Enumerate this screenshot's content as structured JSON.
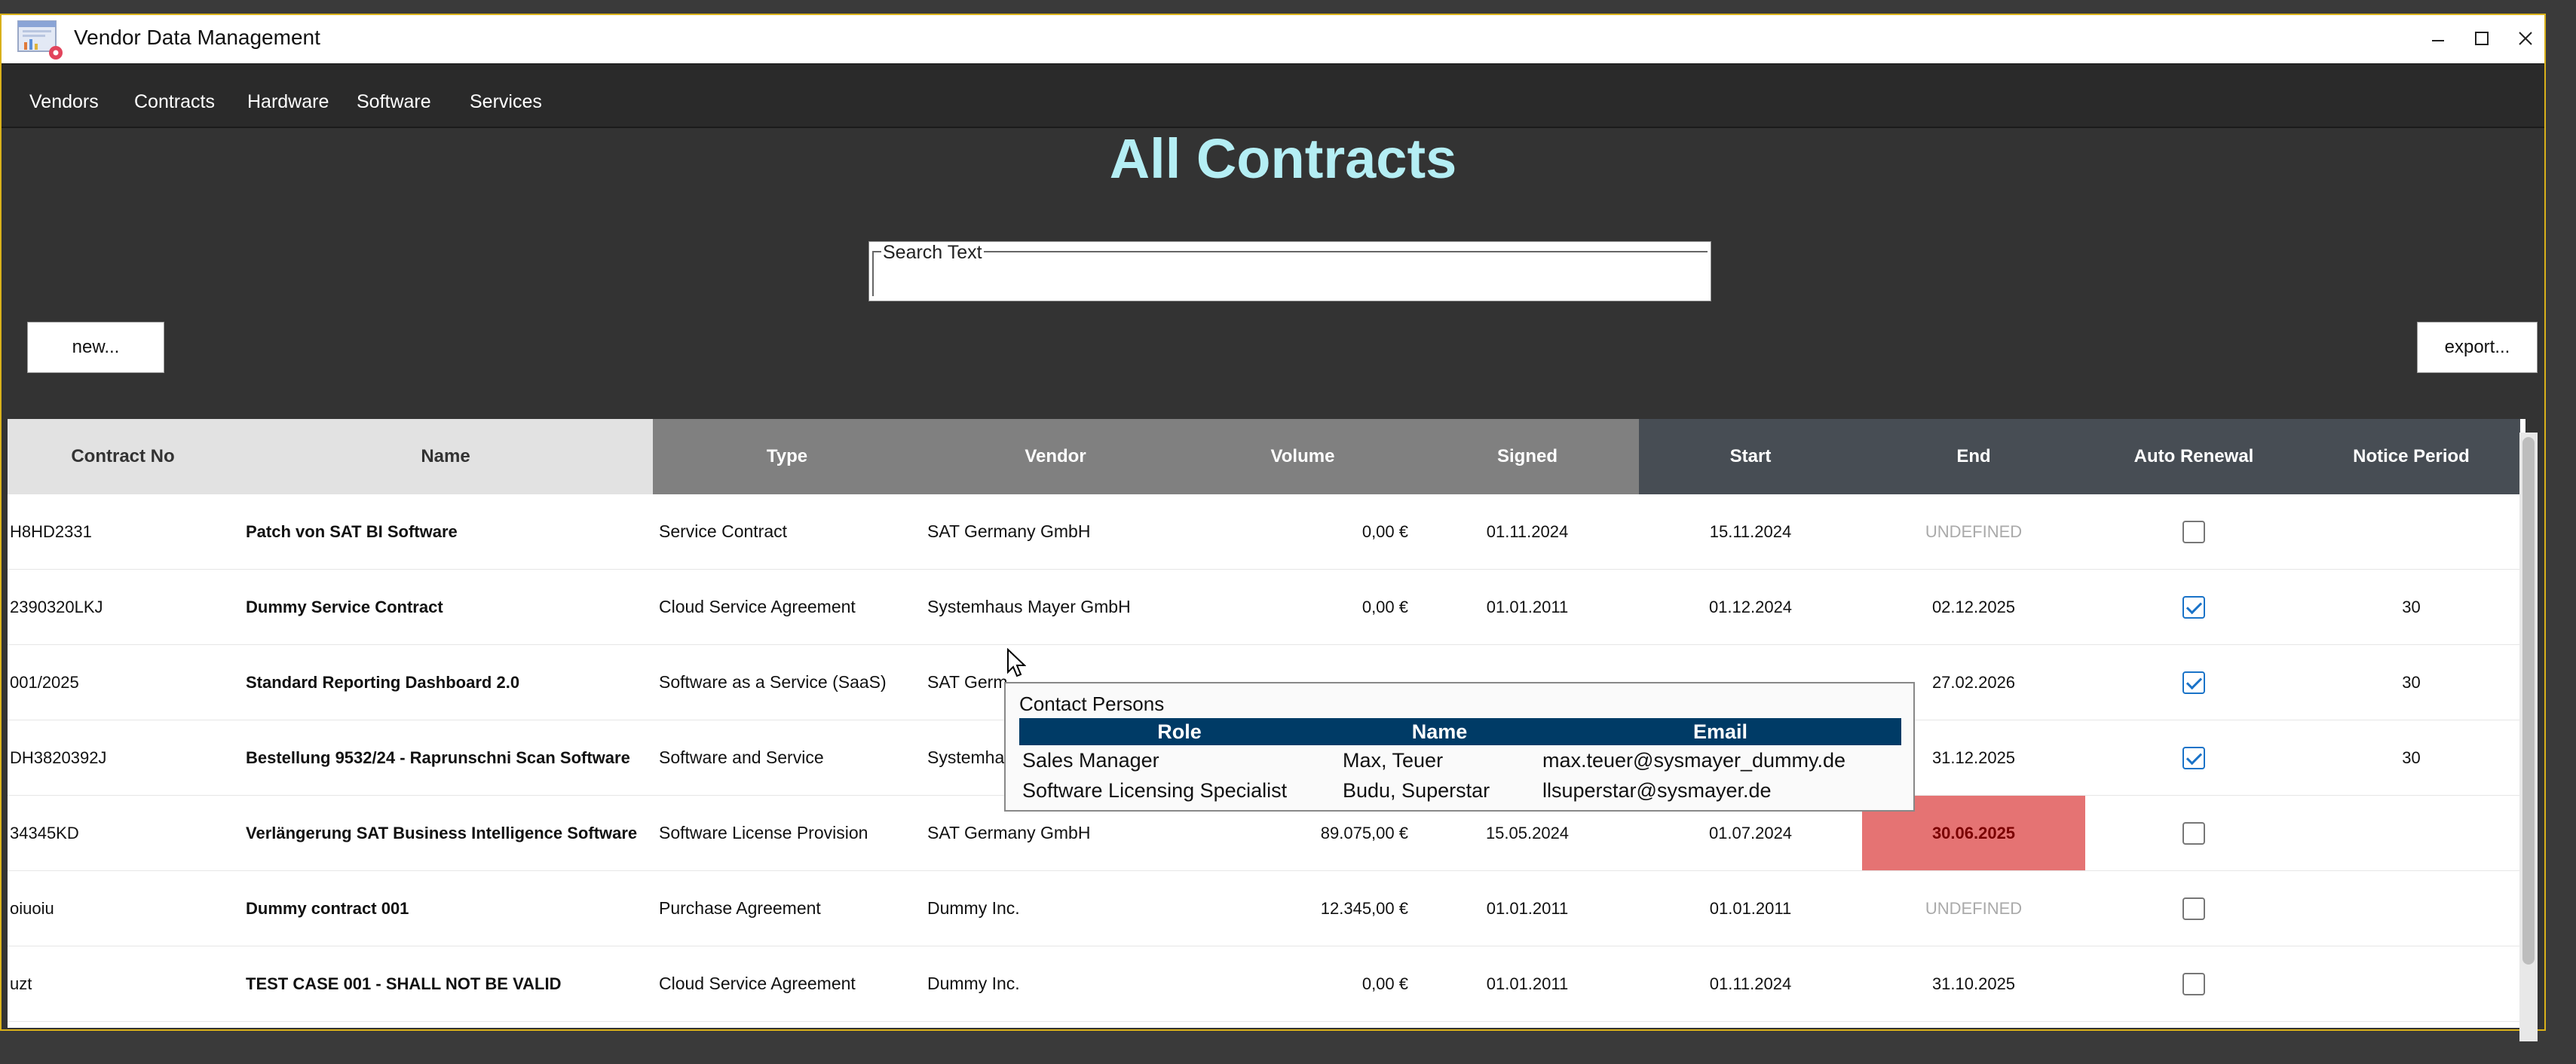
{
  "window": {
    "title": "Vendor Data Management"
  },
  "menu": [
    "Vendors",
    "Contracts",
    "Hardware",
    "Software",
    "Services"
  ],
  "page": {
    "title": "All Contracts"
  },
  "search": {
    "label": "Search Text",
    "value": ""
  },
  "buttons": {
    "new": "new...",
    "export": "export..."
  },
  "table": {
    "headers": [
      "Contract No",
      "Name",
      "Type",
      "Vendor",
      "Volume",
      "Signed",
      "Start",
      "End",
      "Auto Renewal",
      "Notice Period"
    ],
    "rows": [
      {
        "no": "H8HD2331",
        "name": "Patch von SAT BI Software",
        "type": "Service Contract",
        "vendor": "SAT Germany GmbH",
        "volume": "0,00 €",
        "signed": "01.11.2024",
        "start": "15.11.2024",
        "end": "UNDEFINED",
        "auto_renewal": false,
        "notice": ""
      },
      {
        "no": "2390320LKJ",
        "name": "Dummy Service Contract",
        "type": "Cloud Service Agreement",
        "vendor": "Systemhaus Mayer GmbH",
        "volume": "0,00 €",
        "signed": "01.01.2011",
        "start": "01.12.2024",
        "end": "02.12.2025",
        "auto_renewal": true,
        "notice": "30"
      },
      {
        "no": "001/2025",
        "name": "Standard Reporting Dashboard 2.0",
        "type": "Software as a Service (SaaS)",
        "vendor": "SAT Germ",
        "volume": "",
        "signed": "",
        "start": "",
        "end": "27.02.2026",
        "auto_renewal": true,
        "notice": "30"
      },
      {
        "no": "DH3820392J",
        "name": "Bestellung 9532/24 - Raprunschni Scan Software",
        "type": "Software and Service",
        "vendor": "Systemha",
        "volume": "",
        "signed": "",
        "start": "",
        "end": "31.12.2025",
        "auto_renewal": true,
        "notice": "30"
      },
      {
        "no": "34345KD",
        "name": "Verlängerung SAT Business Intelligence Software",
        "type": "Software License Provision",
        "vendor": "SAT Germany GmbH",
        "volume": "89.075,00 €",
        "signed": "15.05.2024",
        "start": "01.07.2024",
        "end": "30.06.2025",
        "auto_renewal": false,
        "notice": ""
      },
      {
        "no": "oiuoiu",
        "name": "Dummy contract 001",
        "type": "Purchase Agreement",
        "vendor": "Dummy Inc.",
        "volume": "12.345,00 €",
        "signed": "01.01.2011",
        "start": "01.01.2011",
        "end": "UNDEFINED",
        "auto_renewal": false,
        "notice": ""
      },
      {
        "no": "uzt",
        "name": "TEST CASE 001 - SHALL NOT BE VALID",
        "type": "Cloud Service Agreement",
        "vendor": "Dummy Inc.",
        "volume": "0,00 €",
        "signed": "01.01.2011",
        "start": "01.11.2024",
        "end": "31.10.2025",
        "auto_renewal": false,
        "notice": ""
      }
    ]
  },
  "tooltip": {
    "title": "Contact Persons",
    "headers": [
      "Role",
      "Name",
      "Email"
    ],
    "rows": [
      [
        "Sales Manager",
        "Max, Teuer",
        "max.teuer@sysmayer_dummy.de"
      ],
      [
        "Software Licensing Specialist",
        "Budu, Superstar",
        "llsuperstar@sysmayer.de"
      ]
    ]
  },
  "colors": {
    "title": "#b4eef4",
    "expired": "#e57373",
    "tooltip_header": "#003b66",
    "checkbox_on": "#1a73c8"
  }
}
